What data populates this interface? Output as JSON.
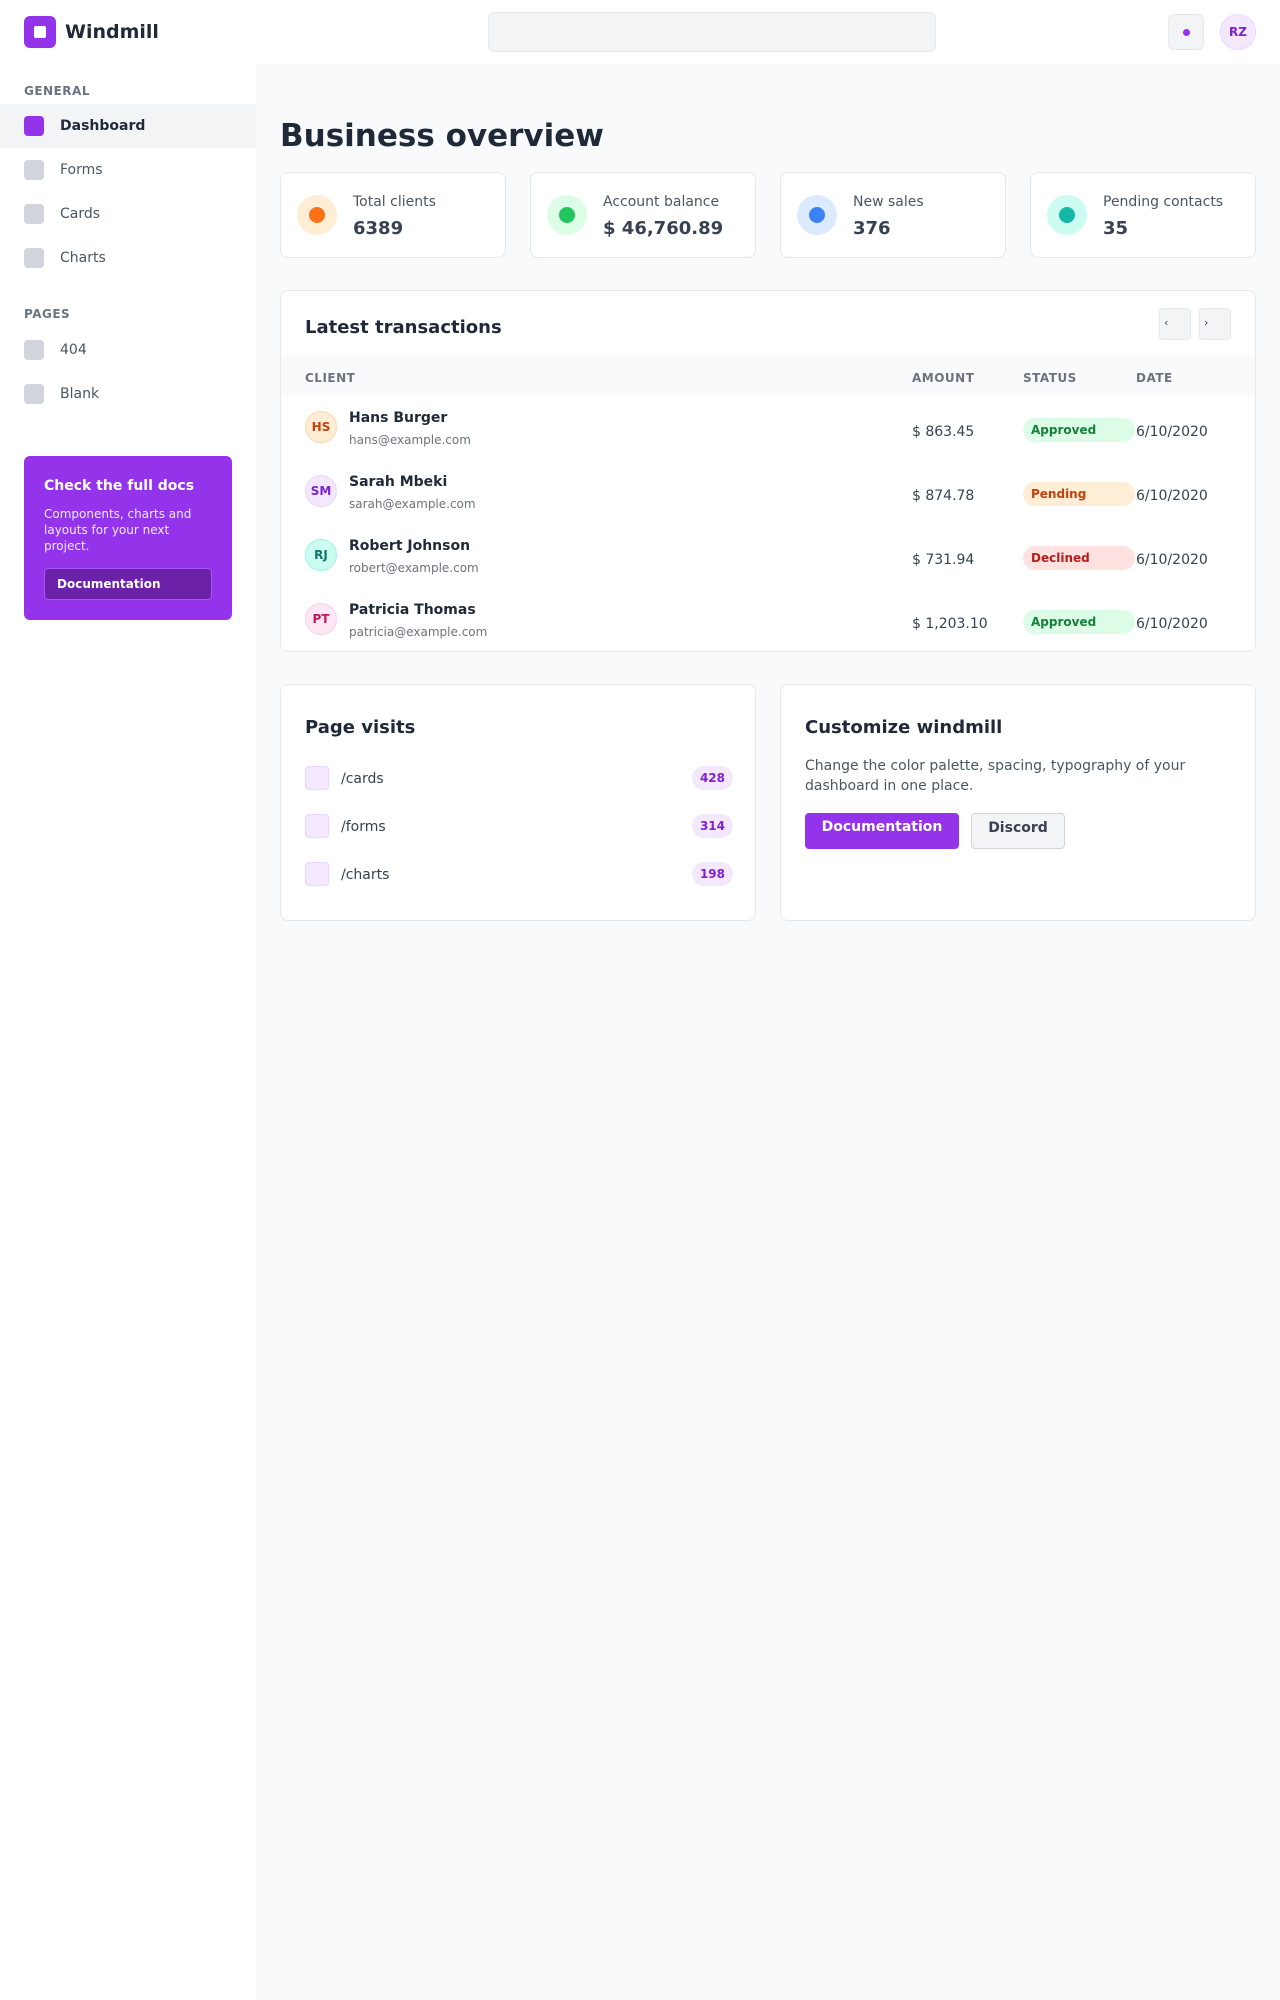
{
  "app": {
    "name": "Windmill",
    "user_initials": "RZ"
  },
  "search": {
    "placeholder": ""
  },
  "sidebar": {
    "general_heading": "GENERAL",
    "pages_heading": "PAGES",
    "general_items": [
      {
        "label": "Dashboard",
        "active": true
      },
      {
        "label": "Forms"
      },
      {
        "label": "Cards"
      },
      {
        "label": "Charts"
      }
    ],
    "pages_items": [
      {
        "label": "404"
      },
      {
        "label": "Blank"
      }
    ],
    "promo": {
      "title": "Check the full docs",
      "text": "Components, charts and layouts for your next project.",
      "button": "Documentation"
    }
  },
  "main": {
    "title": "Business overview",
    "stats": [
      {
        "label": "Total clients",
        "value": "6389",
        "color": "#f97316",
        "bg": "#ffedd5"
      },
      {
        "label": "Account balance",
        "value": "$ 46,760.89",
        "color": "#22c55e",
        "bg": "#dcfce7"
      },
      {
        "label": "New sales",
        "value": "376",
        "color": "#3b82f6",
        "bg": "#dbeafe"
      },
      {
        "label": "Pending contacts",
        "value": "35",
        "color": "#14b8a6",
        "bg": "#ccfbf1"
      }
    ],
    "transactions": {
      "title": "Latest transactions",
      "prev": "‹",
      "next": "›",
      "columns": [
        "CLIENT",
        "AMOUNT",
        "STATUS",
        "DATE"
      ],
      "rows": [
        {
          "initials": "HS",
          "name": "Hans Burger",
          "email": "hans@example.com",
          "amount": "$ 863.45",
          "status": "Approved",
          "date": "6/10/2020"
        },
        {
          "initials": "SM",
          "name": "Sarah Mbeki",
          "email": "sarah@example.com",
          "amount": "$ 874.78",
          "status": "Pending",
          "date": "6/10/2020"
        },
        {
          "initials": "RJ",
          "name": "Robert Johnson",
          "email": "robert@example.com",
          "amount": "$ 731.94",
          "status": "Declined",
          "date": "6/10/2020"
        },
        {
          "initials": "PT",
          "name": "Patricia Thomas",
          "email": "patricia@example.com",
          "amount": "$ 1,203.10",
          "status": "Approved",
          "date": "6/10/2020"
        }
      ]
    },
    "visits": {
      "title": "Page visits",
      "items": [
        {
          "path": "/cards",
          "count": "428"
        },
        {
          "path": "/forms",
          "count": "314"
        },
        {
          "path": "/charts",
          "count": "198"
        }
      ]
    },
    "customize": {
      "title": "Customize windmill",
      "text": "Change the color palette, spacing, typography of your dashboard in one place.",
      "primary_button": "Documentation",
      "secondary_button": "Discord"
    }
  },
  "colors": {
    "accent": "#9333ea",
    "approved_bg": "#dcfce7",
    "approved_fg": "#15803d",
    "pending_bg": "#ffedd5",
    "pending_fg": "#c2410c",
    "declined_bg": "#fee2e2",
    "declined_fg": "#b91c1c"
  }
}
